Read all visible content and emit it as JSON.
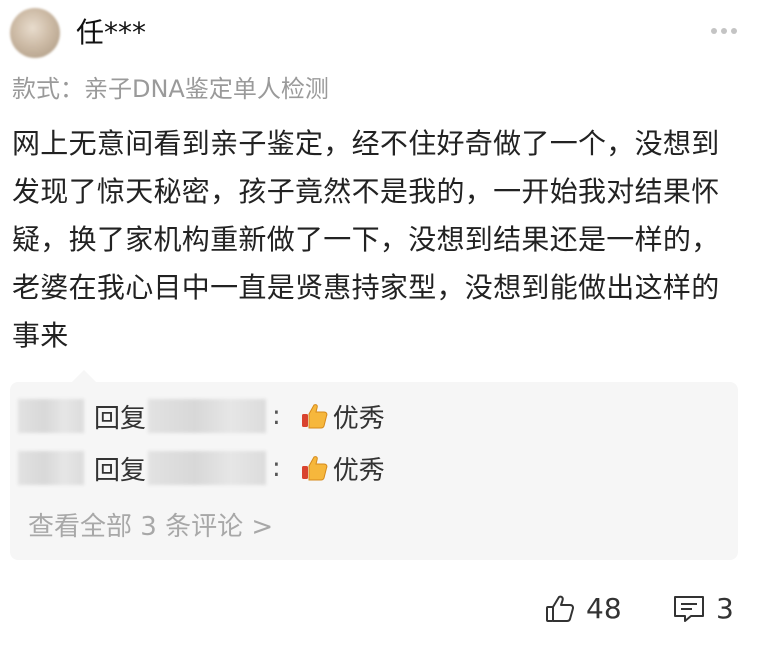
{
  "user": {
    "name": "任***"
  },
  "variant": {
    "text": "款式：亲子DNA鉴定单人检测"
  },
  "review": {
    "text": "网上无意间看到亲子鉴定，经不住好奇做了一个，没想到发现了惊天秘密，孩子竟然不是我的，一开始我对结果怀疑，换了家机构重新做了一下，没想到结果还是一样的，老婆在我心目中一直是贤惠持家型，没想到能做出这样的事来"
  },
  "replies": [
    {
      "reply_word": "回复",
      "colon": ":",
      "text": "优秀",
      "icon": "thumbs-up-emoji"
    },
    {
      "reply_word": "回复",
      "colon": ":",
      "text": "优秀",
      "icon": "thumbs-up-emoji"
    }
  ],
  "view_all": {
    "label": "查看全部 3 条评论 >"
  },
  "footer": {
    "like_count": "48",
    "comment_count": "3",
    "like_icon": "thumbs-up-outline-icon",
    "comment_icon": "comment-icon"
  },
  "colors": {
    "reply_bg": "#f6f6f6",
    "muted_text": "#9a9a9a",
    "main_text": "#222222"
  }
}
